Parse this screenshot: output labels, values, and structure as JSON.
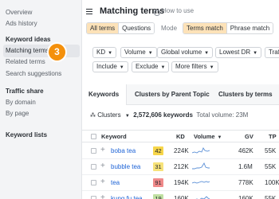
{
  "sidebar": {
    "items_top": [
      "Overview",
      "Ads history"
    ],
    "section_keyword_ideas": "Keyword ideas",
    "keyword_items": [
      "Matching terms",
      "Related terms",
      "Search suggestions"
    ],
    "section_traffic_share": "Traffic share",
    "traffic_items": [
      "By domain",
      "By page"
    ],
    "section_keyword_lists": "Keyword lists",
    "step_badge": "3"
  },
  "header": {
    "title": "Matching terms",
    "how_to": "How to use"
  },
  "scope_toggle": [
    "All terms",
    "Questions"
  ],
  "mode_label": "Mode",
  "mode_toggle": [
    "Terms match",
    "Phrase match"
  ],
  "filters_row1": [
    "KD",
    "Volume",
    "Global volume",
    "Lowest DR",
    "Traf"
  ],
  "filters_row2": [
    "Include",
    "Exclude",
    "More filters"
  ],
  "tabs": [
    "Keywords",
    "Clusters by Parent Topic",
    "Clusters by terms"
  ],
  "summary": {
    "clusters_label": "Clusters",
    "keyword_count": "2,572,606 keywords",
    "total_volume": "Total volume: 23M"
  },
  "table": {
    "headers": {
      "keyword": "Keyword",
      "kd": "KD",
      "volume": "Volume",
      "gv": "GV",
      "tp": "TP"
    },
    "rows": [
      {
        "keyword": "boba tea",
        "kd": "42",
        "volume": "224K",
        "gv": "462K",
        "tp": "55K",
        "kd_color": "#f7d64a"
      },
      {
        "keyword": "bubble tea",
        "kd": "31",
        "volume": "212K",
        "gv": "1.6M",
        "tp": "55K",
        "kd_color": "#f7e37a"
      },
      {
        "keyword": "tea",
        "kd": "91",
        "volume": "194K",
        "gv": "778K",
        "tp": "100K",
        "kd_color": "#f08a8a"
      },
      {
        "keyword": "kung fu tea",
        "kd": "19",
        "volume": "160K",
        "gv": "160K",
        "tp": "55K",
        "kd_color": "#bfe0a1"
      }
    ]
  },
  "colors": {
    "accent_orange": "#f4900c",
    "toggle_on": "#fde2b8",
    "link_blue": "#1d63d6"
  }
}
